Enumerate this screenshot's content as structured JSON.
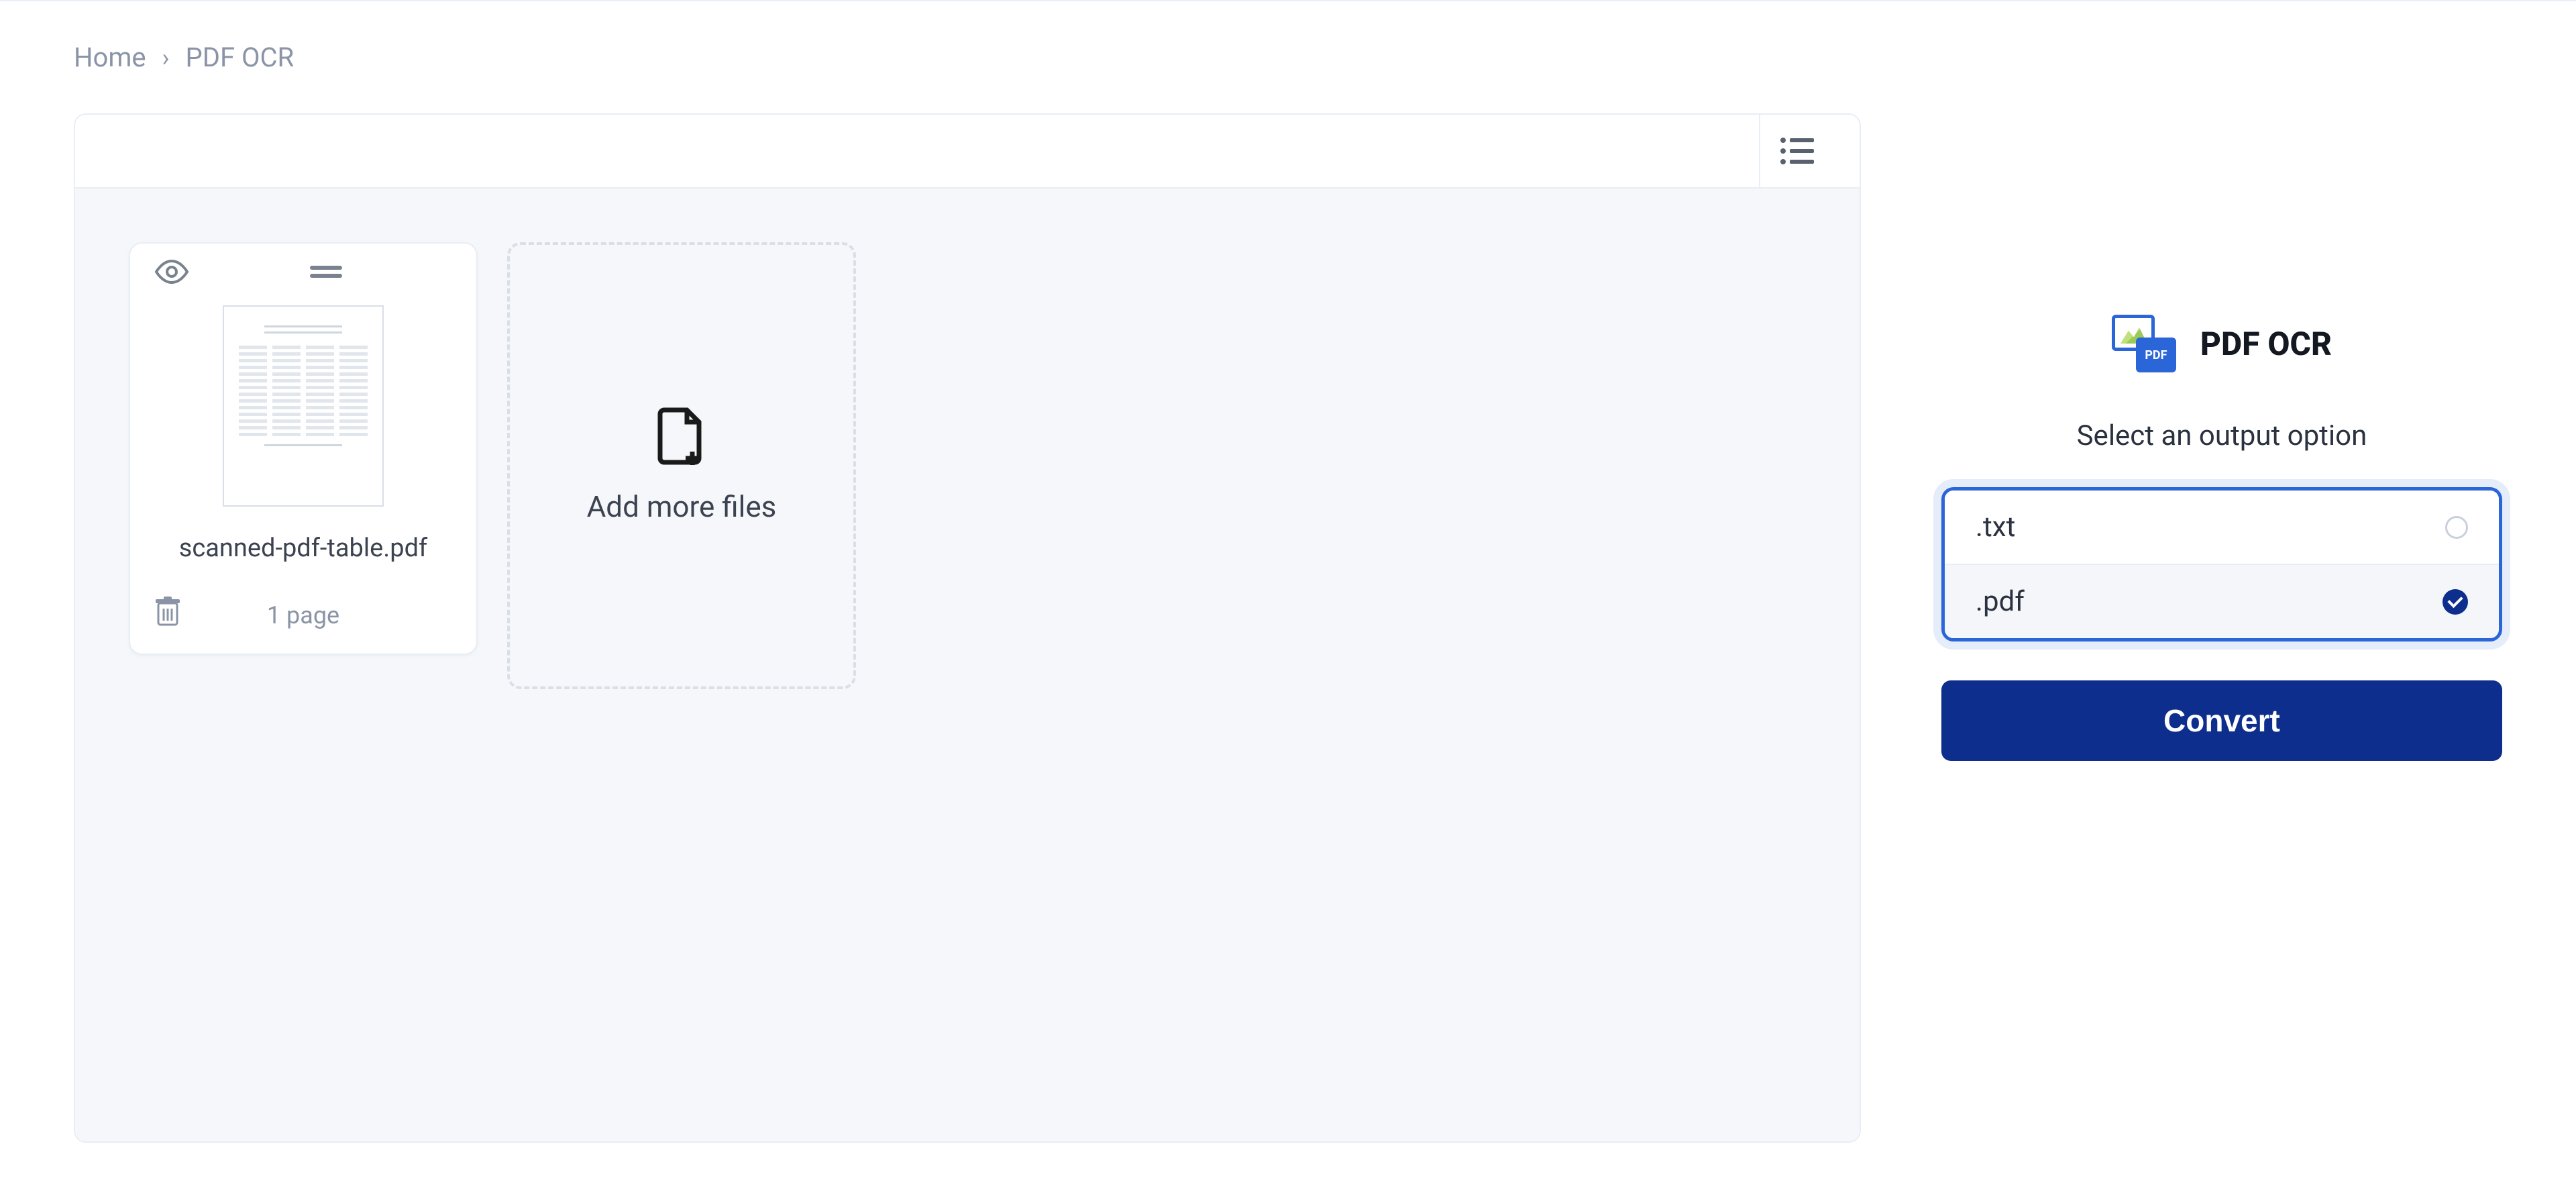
{
  "breadcrumb": {
    "home": "Home",
    "current": "PDF OCR"
  },
  "files": {
    "items": [
      {
        "name": "scanned-pdf-table.pdf",
        "pages_label": "1 page"
      }
    ],
    "add_label": "Add more files"
  },
  "side": {
    "title": "PDF OCR",
    "pdf_badge": "PDF",
    "subtitle": "Select an output option",
    "options": [
      {
        "label": ".txt",
        "selected": false
      },
      {
        "label": ".pdf",
        "selected": true
      }
    ],
    "convert_label": "Convert"
  }
}
